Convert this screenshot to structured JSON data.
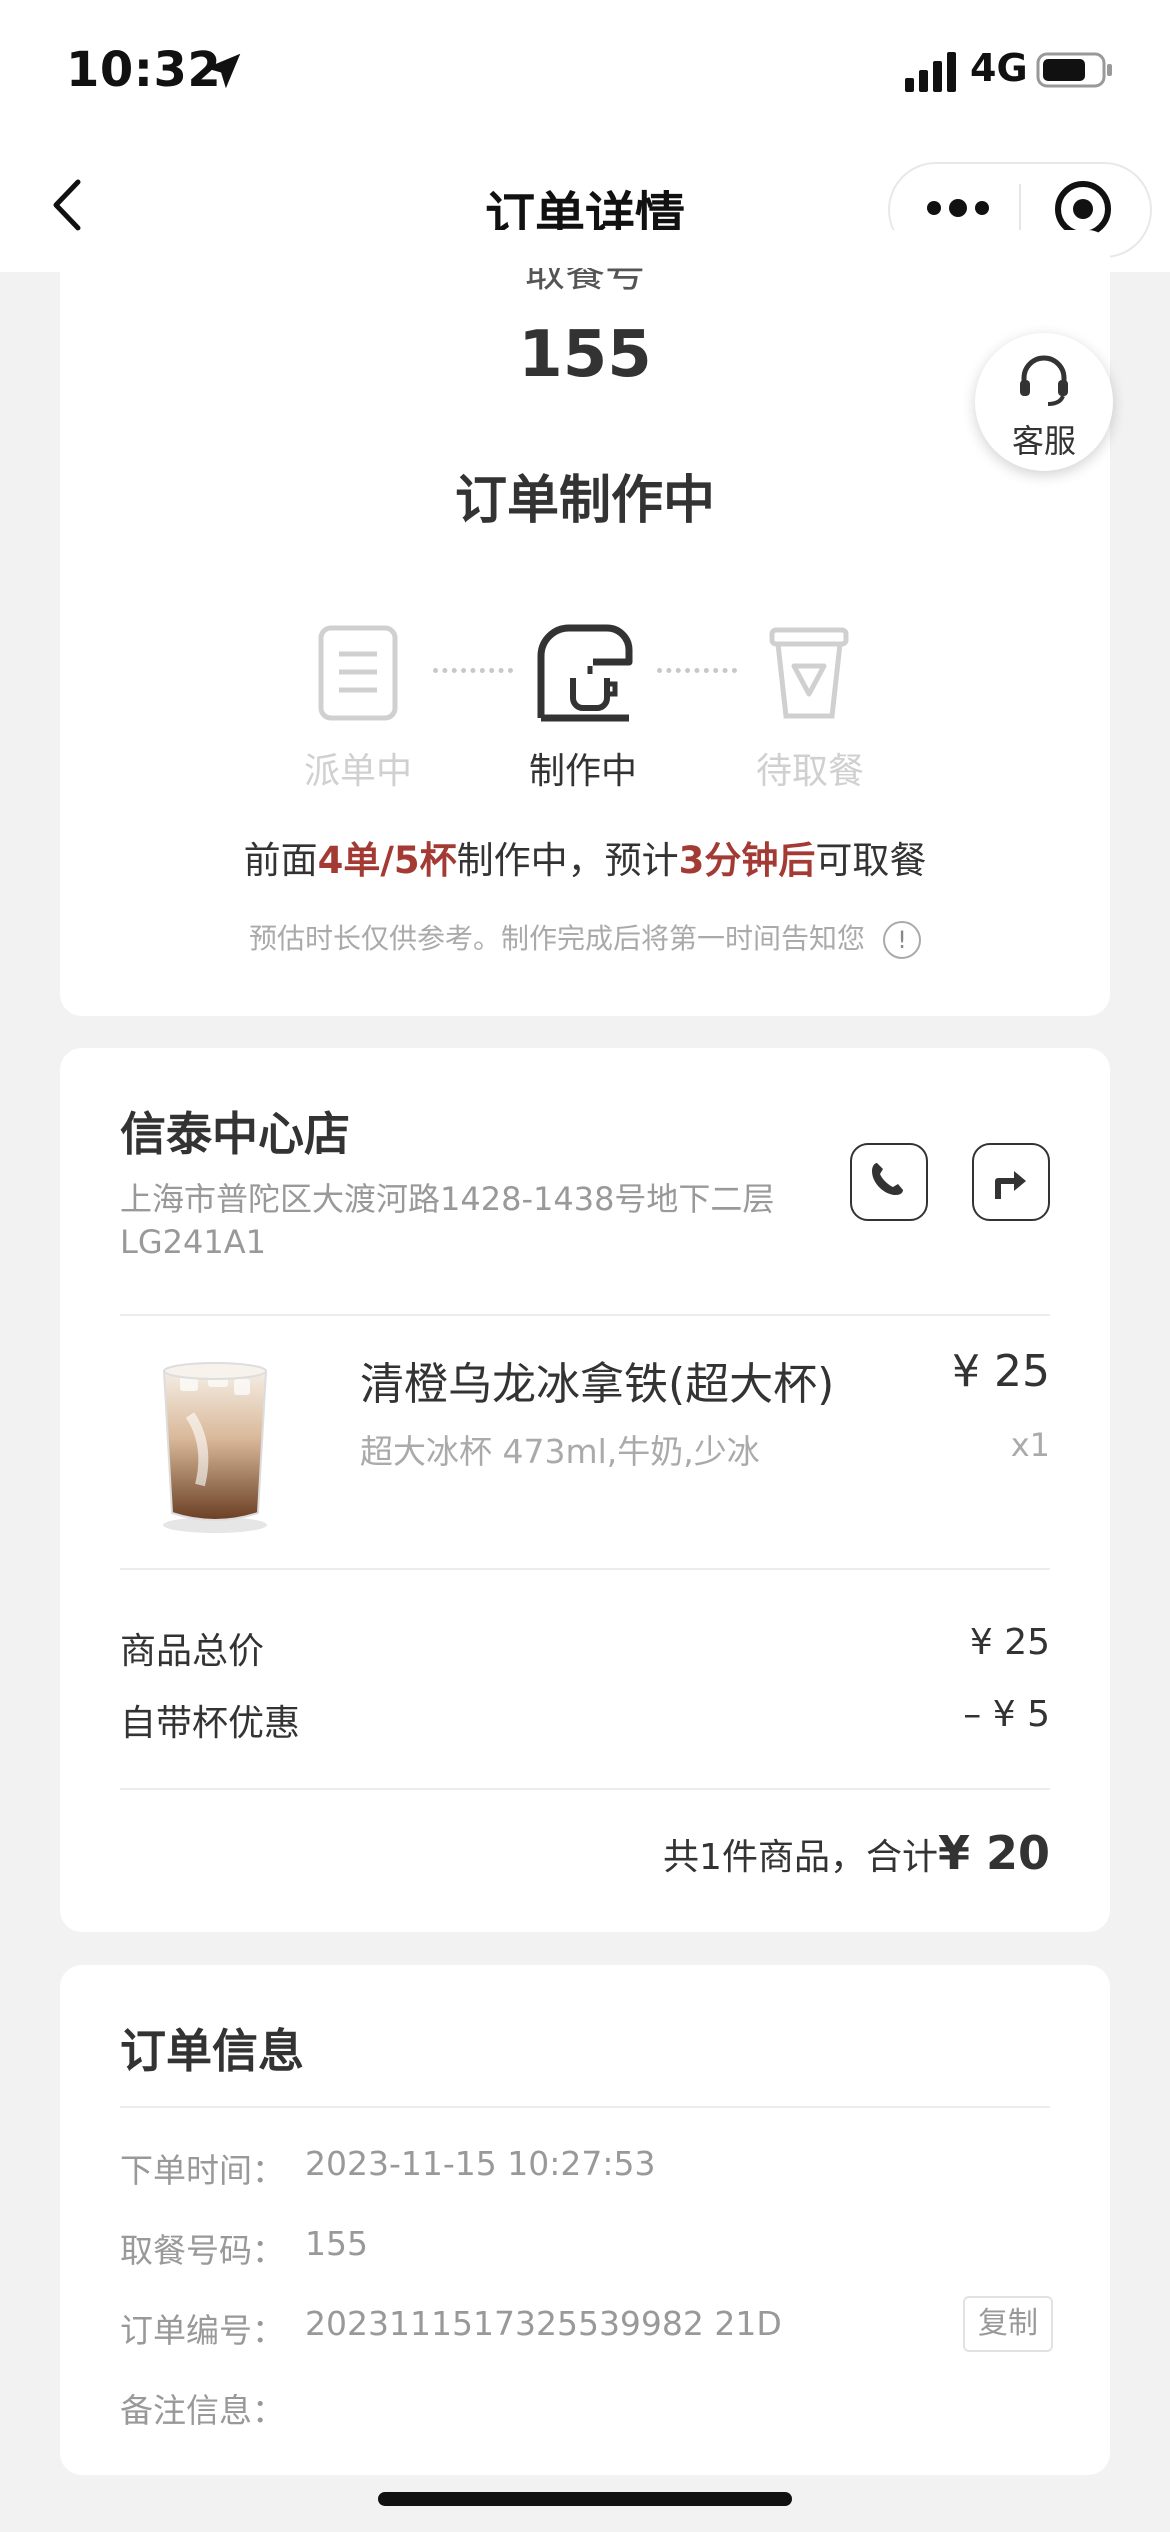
{
  "status_bar": {
    "time": "10:32",
    "network": "4G"
  },
  "nav": {
    "title": "订单详情"
  },
  "order_status": {
    "partial_label": "取餐号",
    "pickup_number": "155",
    "title": "订单制作中",
    "steps": [
      {
        "label": "派单中",
        "active": false
      },
      {
        "label": "制作中",
        "active": true
      },
      {
        "label": "待取餐",
        "active": false
      }
    ],
    "progress_prefix": "前面",
    "progress_queue": "4单/5杯",
    "progress_mid": "制作中，预计",
    "progress_eta": "3分钟后",
    "progress_suffix": "可取餐",
    "note": "预估时长仅供参考。制作完成后将第一时间告知您",
    "info_icon": "!"
  },
  "customer_service": {
    "label": "客服"
  },
  "store": {
    "name": "信泰中心店",
    "address": "上海市普陀区大渡河路1428-1438号地下二层LG241A1"
  },
  "product": {
    "name": "清橙乌龙冰拿铁(超大杯)",
    "options": "超大冰杯 473ml,牛奶,少冰",
    "price": "¥ 25",
    "qty": "x1"
  },
  "summary": {
    "subtotal_label": "商品总价",
    "subtotal_value": "¥ 25",
    "discount_label": "自带杯优惠",
    "discount_value": "– ¥ 5",
    "total_prefix": "共1件商品，合计",
    "total_amount": "¥ 20"
  },
  "order_info": {
    "title": "订单信息",
    "rows": [
      {
        "label": "下单时间：",
        "value": "2023-11-15 10:27:53"
      },
      {
        "label": "取餐号码：",
        "value": "155"
      },
      {
        "label": "订单编号：",
        "value": "2023111517325539982 21D"
      },
      {
        "label": "备注信息：",
        "value": ""
      }
    ],
    "copy_label": "复制"
  },
  "colors": {
    "highlight": "#a33a33",
    "active": "#333333",
    "inactive": "#d0d0d0"
  }
}
